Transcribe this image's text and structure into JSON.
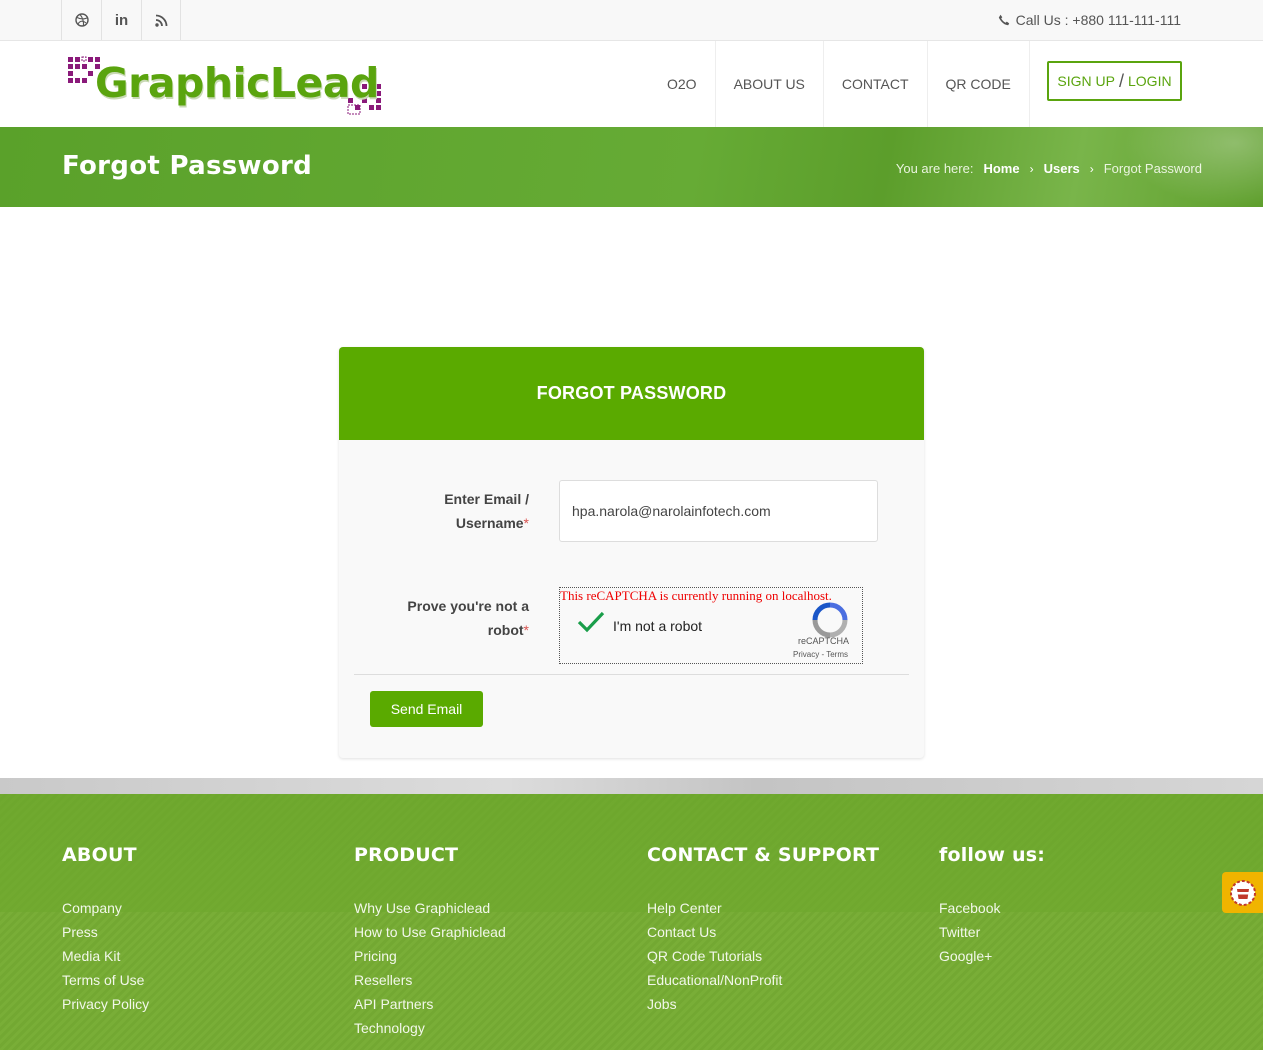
{
  "topbar": {
    "social_icons": [
      "dribbble-icon",
      "linkedin-icon",
      "rss-icon"
    ],
    "linkedin_label": "in",
    "call_label": "Call Us : +880 111-111-111"
  },
  "header": {
    "logo_text": "GraphicLead",
    "nav": [
      "O2O",
      "ABOUT US",
      "CONTACT",
      "QR CODE"
    ],
    "signup_label": "SIGN UP",
    "separator": "/",
    "login_label": "LOGIN"
  },
  "titlebar": {
    "title": "Forgot Password",
    "breadcrumb_prefix": "You are here:",
    "crumbs": [
      "Home",
      "Users",
      "Forgot Password"
    ]
  },
  "form": {
    "heading": "FORGOT PASSWORD",
    "email_label_line1": "Enter Email /",
    "email_label_line2": "Username",
    "email_value": "hpa.narola@narolainfotech.com",
    "robot_label_line1": "Prove you're not a",
    "robot_label_line2": "robot",
    "required_mark": "*",
    "recaptcha_warning": "This reCAPTCHA is currently running on localhost.",
    "recaptcha_text": "I'm not a robot",
    "recaptcha_brand": "reCAPTCHA",
    "recaptcha_links": "Privacy - Terms",
    "submit_label": "Send Email"
  },
  "footer": {
    "about": {
      "title": "ABOUT",
      "items": [
        "Company",
        "Press",
        "Media Kit",
        "Terms of Use",
        "Privacy Policy"
      ]
    },
    "product": {
      "title": "PRODUCT",
      "items": [
        "Why Use Graphiclead",
        "How to Use Graphiclead",
        "Pricing",
        "Resellers",
        "API Partners",
        "Technology"
      ]
    },
    "contact": {
      "title": "CONTACT & SUPPORT",
      "items": [
        "Help Center",
        "Contact Us",
        "QR Code Tutorials",
        "Educational/NonProfit",
        "Jobs"
      ]
    },
    "follow": {
      "title": "follow us:",
      "items": [
        "Facebook",
        "Twitter",
        "Google+"
      ]
    }
  },
  "colors": {
    "brand_green": "#5aaa00",
    "logo_purple": "#8a1a7a",
    "badge_yellow": "#f0b400"
  }
}
